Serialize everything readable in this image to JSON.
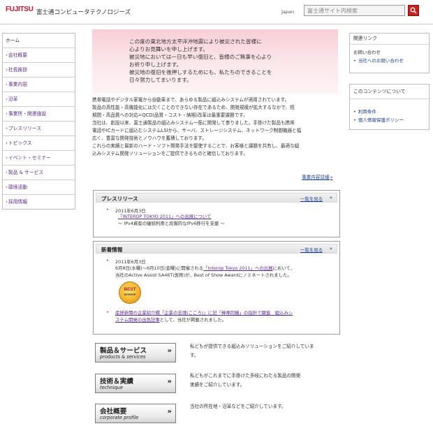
{
  "header": {
    "logo": "FUJITSU",
    "company": "富士通コンピュータテクノロジーズ",
    "country": "Japan",
    "search_placeholder": "富士通サイト内検索",
    "search_icon": "search-icon"
  },
  "sidebar": {
    "items": [
      {
        "label": "ホーム",
        "arrow": ""
      },
      {
        "label": "会社概要",
        "arrow": "›"
      },
      {
        "label": "社長挨拶",
        "arrow": "›"
      },
      {
        "label": "事業内容",
        "arrow": "›"
      },
      {
        "label": "沿革",
        "arrow": "›"
      },
      {
        "label": "事業所・関連施設",
        "arrow": "›"
      },
      {
        "label": "プレスリリース",
        "arrow": "›"
      },
      {
        "label": "トピックス",
        "arrow": "›"
      },
      {
        "label": "イベント・セミナー",
        "arrow": "›"
      },
      {
        "label": "製品 & サービス",
        "arrow": "›"
      },
      {
        "label": "環境活動",
        "arrow": "›"
      },
      {
        "label": "採用情報",
        "arrow": "›"
      }
    ]
  },
  "notice": {
    "lines": [
      "この度の東北地方太平洋沖地震により被災された皆様に",
      "心よりお見舞いを申し上げます。",
      "被災地においては一日も早い復旧と、皆様のご無事を心より",
      "お祈り申し上げます。",
      "被災地の復旧を後押しするためにも、私たちのできることを",
      "日々努力してまいります。"
    ]
  },
  "intro": {
    "lines": [
      "携帯電話やデジタル家電から自動車まで、あらゆる製品に組込みシステムが適用されています。",
      "製品の高性能・高機能化には欠くことのできない存在であるため、開発規模が拡大するなかで、短",
      "期間・高品質への対応=QCD(品質・コスト・納期)改革は最重要課題です。",
      "当社は、創設以来、富士通製品の組込みシステム一筋に開発して参りました。手掛けた製品も携帯",
      "電話やICカードに組込むシステムLSIから、サーバ、ストレージシステム、ネットワーク制御機器と幅",
      "広く、豊富な開発技術とノウハウを蓄積しております。",
      "これらの実績と最新のハード・ソフト開発手法を駆使することで、お客様と課題を共有し、最適な組",
      "込みシステム開発ソリューションをご提供できるものと確信しております。"
    ],
    "more": "事業内容詳細",
    "more_arrow": "»"
  },
  "press": {
    "title": "プレスリリース",
    "more": "一覧を見る",
    "more_arrow": "»",
    "entries": [
      {
        "bullet": "•",
        "date": "2011年6月3日",
        "link": "「INTEROP TOKYO 2011」への出展について",
        "sub": "～ IPv4資産の継続利用と段階的なIPv6移行を支援 ～"
      }
    ]
  },
  "news": {
    "title": "新着情報",
    "more": "一覧を見る",
    "more_arrow": "»",
    "entry1": {
      "bullet": "•",
      "date": "2011年6月3日",
      "pre": "6月8日(水曜)～6月10日(金曜)に開催される",
      "link": "「Interop Tokyo 2011」への出展",
      "post": "において、",
      "line2": "当社のActive Assist SA46T(仮称)が、Best of Show Awardにノミネートされました。"
    },
    "badge": {
      "top": "BEST",
      "bottom": "INTEROP"
    },
    "entry2": {
      "bullet": "•",
      "link": "産経新聞の企業紹介欄「企業の志魂(こころ)」に記「棒啄同機」の指針で躍進　組込みシ",
      "line2_link": "ステム開発の出色記事",
      "line2_post": "として、当社が掲載されました。"
    }
  },
  "banners": [
    {
      "title": "製品＆サービス",
      "subtitle": "products & services",
      "arrow": "»",
      "desc": [
        "私どもが提供できる組込みソリューションをご紹介していま",
        "す。"
      ]
    },
    {
      "title": "技術＆実績",
      "subtitle": "technique",
      "arrow": "»",
      "desc": [
        "私どもがこれまでに手掛けた多岐にわたる製品の開発",
        "実績をご紹介しています。"
      ]
    },
    {
      "title": "会社概要",
      "subtitle": "corporate profile",
      "arrow": "»",
      "desc": [
        "当社の所在地・沿革などをご紹介しています。"
      ]
    }
  ],
  "right": {
    "related": {
      "title": "関連リンク",
      "contact_label": "お問い合わせ",
      "contact_link": "当社へのお問い合わせ"
    },
    "about": {
      "title": "このコンテンツについて",
      "links": [
        "利用条件",
        "個人情報保護ポリシー"
      ]
    }
  },
  "colors": {
    "brand": "#c8102e",
    "link": "#1a3f8f",
    "visited": "#5a2d8a",
    "notice_bg": "#f7cfd5"
  }
}
